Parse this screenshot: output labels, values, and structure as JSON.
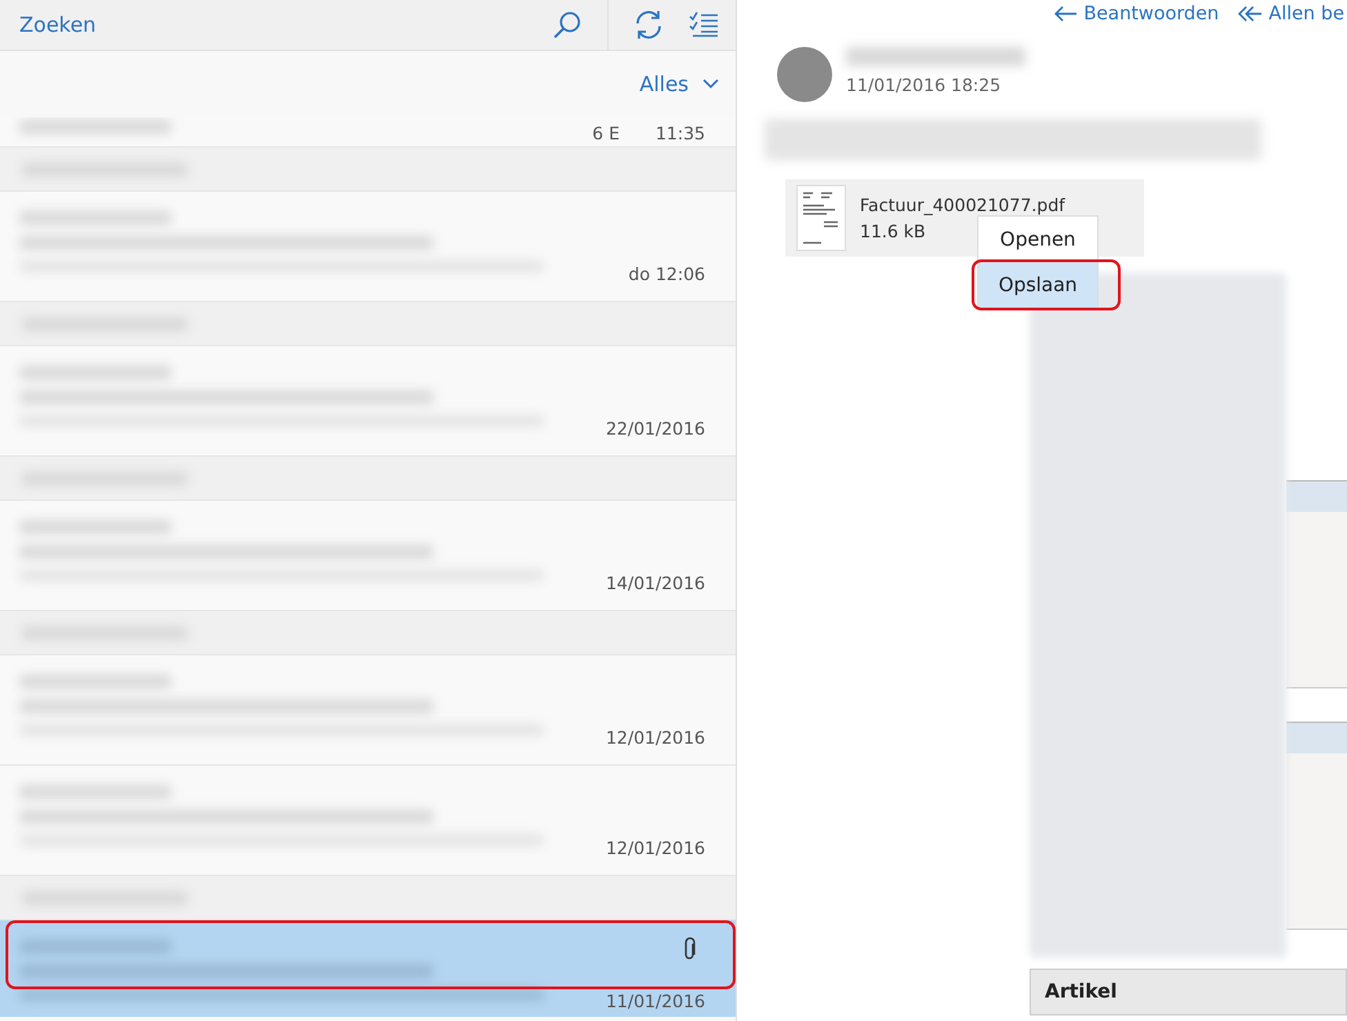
{
  "search": {
    "placeholder": "Zoeken"
  },
  "filter": {
    "label": "Alles"
  },
  "messages": [
    {
      "kind": "partial",
      "meta": "6 E",
      "time": "11:35",
      "attachment": false,
      "selected": false,
      "highlighted": false
    },
    {
      "kind": "group"
    },
    {
      "kind": "mail",
      "time": "do 12:06",
      "attachment": false,
      "selected": false,
      "highlighted": false
    },
    {
      "kind": "group"
    },
    {
      "kind": "mail",
      "time": "22/01/2016",
      "attachment": false,
      "selected": false,
      "highlighted": false
    },
    {
      "kind": "group"
    },
    {
      "kind": "mail",
      "time": "14/01/2016",
      "attachment": false,
      "selected": false,
      "highlighted": false
    },
    {
      "kind": "group"
    },
    {
      "kind": "mail",
      "time": "12/01/2016",
      "attachment": false,
      "selected": false,
      "highlighted": false
    },
    {
      "kind": "mail",
      "time": "12/01/2016",
      "attachment": false,
      "selected": false,
      "highlighted": false
    },
    {
      "kind": "group"
    },
    {
      "kind": "mail",
      "time": "11/01/2016",
      "attachment": true,
      "selected": true,
      "highlighted": true
    }
  ],
  "actions": [
    {
      "label": "Beantwoorden",
      "kind": "reply"
    },
    {
      "label": "Allen be",
      "kind": "reply-all"
    }
  ],
  "sender": {
    "date": "11/01/2016 18:25"
  },
  "attachment": {
    "name": "Factuur_400021077.pdf",
    "size": "11.6 kB"
  },
  "context_menu": [
    {
      "label": "Openen",
      "selected": false,
      "highlighted": false
    },
    {
      "label": "Opslaan",
      "selected": true,
      "highlighted": true
    }
  ],
  "body": {
    "table_header": "Artikel"
  }
}
